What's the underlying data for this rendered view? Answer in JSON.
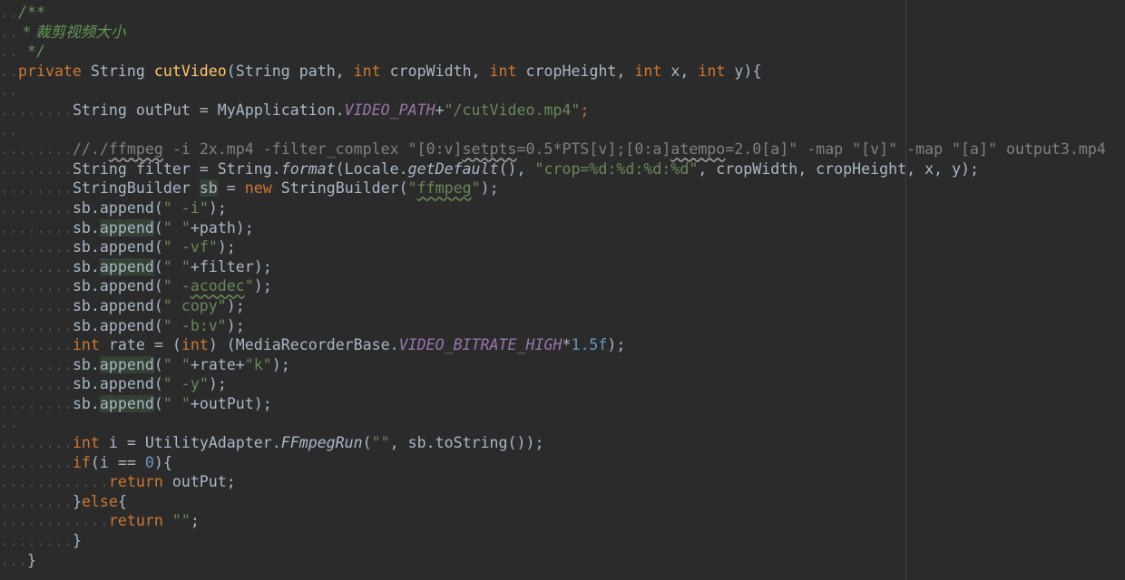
{
  "editor": {
    "language": "java",
    "colors": {
      "background": "#2b2b2b",
      "keyword": "#cc7832",
      "method": "#ffc66d",
      "string": "#6a8759",
      "number": "#6897bb",
      "static_field": "#9876aa",
      "comment": "#808080",
      "doc_comment": "#629755",
      "text": "#a9b7c6"
    },
    "doc": {
      "open": "/**",
      "body": " * 裁剪视频大小",
      "close": " */"
    },
    "signature": {
      "mod": "private",
      "ret": " String ",
      "name": "cutVideo",
      "p1": "(String path, ",
      "t_int": "int",
      "p2": " cropWidth, ",
      "p3": " cropHeight, ",
      "p4": " x, ",
      "p5": " y){"
    },
    "line_output": {
      "a": "String outPut = MyApplication.",
      "field": "VIDEO_PATH",
      "b": "+",
      "str": "\"/cutVideo.mp4\"",
      "c": ";"
    },
    "line_comment": {
      "a": "//./",
      "b": "ffmpeg",
      "c": " -i 2x.mp4 -filter_complex \"[0:v]",
      "d": "setpts",
      "e": "=0.5*PTS[v];[0:a]",
      "f": "atempo",
      "g": "=2.0[a]\" -map \"[v]\" -map \"[a]\" output3.mp4"
    },
    "line_filter": {
      "a": "String filter = String.",
      "format": "format",
      "b": "(Locale.",
      "getdef": "getDefault",
      "c": "(), ",
      "str": "\"crop=%d:%d:%d:%d\"",
      "d": ", cropWidth, cropHeight, x, y);"
    },
    "line_sb": {
      "a": "StringBuilder ",
      "var": "sb",
      "b": " = ",
      "kw": "new",
      "c": " StringBuilder(",
      "q1": "\"",
      "ff": "ffmpeg",
      "q2": "\"",
      "d": ");"
    },
    "append_lines": [
      {
        "pre": "sb.",
        "m": "append",
        "hl": false,
        "open": "(",
        "s": "\" -i\"",
        "rest": ");"
      },
      {
        "pre": "sb.",
        "m": "append",
        "hl": true,
        "open": "(",
        "s": "\" \"",
        "rest": "+path);"
      },
      {
        "pre": "sb.",
        "m": "append",
        "hl": false,
        "open": "(",
        "s": "\" -vf\"",
        "rest": ");"
      },
      {
        "pre": "sb.",
        "m": "append",
        "hl": true,
        "open": "(",
        "s": "\" \"",
        "rest": "+filter);"
      }
    ],
    "line_acodec": {
      "pre": "sb.append(",
      "s1": "\" -",
      "acodec": "acodec",
      "s2": "\"",
      "rest": ");"
    },
    "append_lines2": [
      {
        "pre": "sb.append(",
        "s": "\" copy\"",
        "rest": ");"
      },
      {
        "pre": "sb.append(",
        "s": "\" -b:v\"",
        "rest": ");"
      }
    ],
    "line_rate": {
      "kw": "int",
      "a": " rate = (",
      "kw2": "int",
      "b": ") (MediaRecorderBase.",
      "field": "VIDEO_BITRATE_HIGH",
      "c": "*",
      "num": "1.5f",
      "d": ");"
    },
    "append_lines3": [
      {
        "pre": "sb.",
        "m": "append",
        "hl": true,
        "open": "(",
        "s": "\" \"",
        "mid": "+rate+",
        "s2": "\"k\"",
        "rest": ");"
      },
      {
        "pre": "sb.",
        "m": "append",
        "hl": false,
        "open": "(",
        "s": "\" -y\"",
        "mid": "",
        "s2": "",
        "rest": ");"
      },
      {
        "pre": "sb.",
        "m": "append",
        "hl": true,
        "open": "(",
        "s": "\" \"",
        "mid": "+outPut",
        "s2": "",
        "rest": ");"
      }
    ],
    "line_run": {
      "kw": "int",
      "a": " i = UtilityAdapter.",
      "m": "FFmpegRun",
      "b": "(",
      "s": "\"\"",
      "c": ", sb.toString());"
    },
    "line_if": {
      "kw": "if",
      "a": "(i == ",
      "num": "0",
      "b": "){"
    },
    "line_ret1": {
      "kw": "return",
      "a": " outPut;"
    },
    "line_else": {
      "a": "}",
      "kw": "else",
      "b": "{"
    },
    "line_ret2": {
      "kw": "return",
      "a": " ",
      "s": "\"\"",
      "b": ";"
    },
    "line_close_if": "}",
    "line_close_method": "}"
  }
}
